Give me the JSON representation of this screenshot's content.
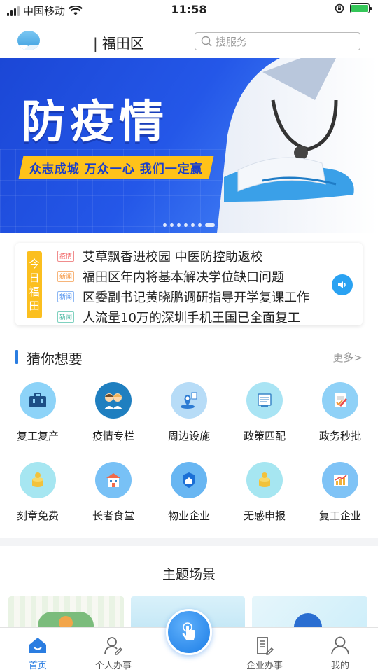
{
  "status_bar": {
    "carrier": "中国移动",
    "time": "11:58"
  },
  "header": {
    "city": "福田区",
    "search_placeholder": "搜服务"
  },
  "banner": {
    "title": "防疫情",
    "slogan": "众志成城 万众一心 我们一定赢",
    "slide_count": 7,
    "active_slide": 7
  },
  "news": {
    "today_label": [
      "今",
      "日",
      "福",
      "田"
    ],
    "items": [
      {
        "tag": "疫情",
        "tag_color": "#f05a5a",
        "text": "艾草飘香进校园 中医防控助返校"
      },
      {
        "tag": "新闻",
        "tag_color": "#f7943a",
        "text": "福田区年内将基本解决学位缺口问题"
      },
      {
        "tag": "新闻",
        "tag_color": "#4a8ff0",
        "text": "区委副书记黄晓鹏调研指导开学复课工作"
      },
      {
        "tag": "新闻",
        "tag_color": "#3bb39a",
        "text": "人流量10万的深圳手机王国已全面复工"
      }
    ]
  },
  "guess": {
    "title": "猜你想要",
    "more": "更多>",
    "services": [
      {
        "label": "复工复产",
        "icon": "briefcase-icon"
      },
      {
        "label": "疫情专栏",
        "icon": "people-icon"
      },
      {
        "label": "周边设施",
        "icon": "location-icon"
      },
      {
        "label": "政策匹配",
        "icon": "document-icon"
      },
      {
        "label": "政务秒批",
        "icon": "approval-icon"
      },
      {
        "label": "刻章免费",
        "icon": "coin-stack-icon"
      },
      {
        "label": "长者食堂",
        "icon": "building-icon"
      },
      {
        "label": "物业企业",
        "icon": "home-shield-icon"
      },
      {
        "label": "无感申报",
        "icon": "coin-stack-icon"
      },
      {
        "label": "复工企业",
        "icon": "bar-chart-icon"
      }
    ]
  },
  "themes": {
    "title": "主题场景"
  },
  "tabbar": {
    "items": [
      {
        "label": "首页",
        "icon": "home-icon",
        "active": true
      },
      {
        "label": "个人办事",
        "icon": "person-edit-icon",
        "active": false
      },
      {
        "label": "企业办事",
        "icon": "building-edit-icon",
        "active": false
      },
      {
        "label": "我的",
        "icon": "user-icon",
        "active": false
      }
    ],
    "center_icon": "hand-tap-icon"
  },
  "colors": {
    "accent": "#2a7de1",
    "banner_blue": "#2457e8",
    "today_yellow": "#fbbf1f"
  }
}
